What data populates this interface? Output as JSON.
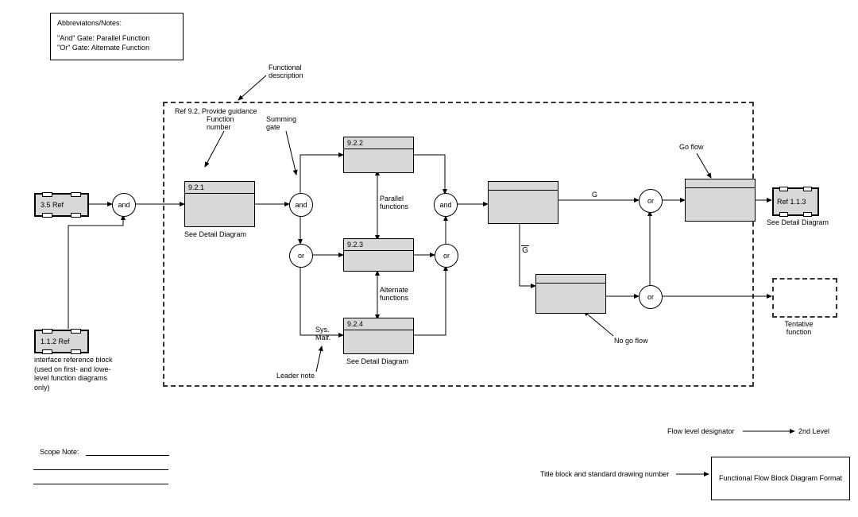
{
  "notes": {
    "title": "Abbreviatons/Notes:",
    "line1": "\"And\" Gate: Parallel Function",
    "line2": "\"Or\" Gate: Alternate Function"
  },
  "annotations": {
    "functional_desc": "Functional description",
    "ref_title": "Ref 9.2, Provide guidance",
    "function_number": "Function number",
    "summing_gate": "Summing gate",
    "see_detail": "See Detail Diagram",
    "see_detail2": "See Detail Diagram",
    "see_detail3": "See Detail Diagram",
    "parallel_functions": "Parallel functions",
    "alternate_functions": "Alternate functions",
    "sys_malf": "Sys. Malf.",
    "leader_note": "Leader note",
    "go_flow": "Go flow",
    "no_go_flow": "No go flow",
    "tentative_function": "Tentative function",
    "interface_note": "interface reference block (used on first- and lowe-level function diagrams only)",
    "G": "G",
    "Gbar": "G",
    "scope_note": "Scope Note:",
    "flow_level_designator": "Flow level designator",
    "second_level": "2nd Level",
    "title_block_note": "Title block and standard drawing number",
    "title_block": "Functional Flow Block Diagram Format"
  },
  "refs": {
    "ref35": "3.5 Ref",
    "ref112": "1.1.2 Ref",
    "ref113": "Ref 1.1.3"
  },
  "blocks": {
    "b921": "9.2.1",
    "b922": "9.2.2",
    "b923": "9.2.3",
    "b924": "9.2.4"
  },
  "gates": {
    "and": "and",
    "or": "or"
  }
}
